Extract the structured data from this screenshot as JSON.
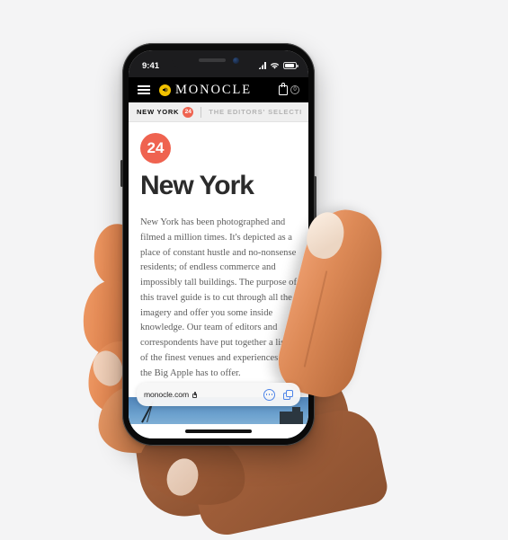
{
  "background_color": "#f4f4f5",
  "device": {
    "name": "iphone-x",
    "frame_color": "#0a0a0a",
    "status_bar": {
      "time": "9:41",
      "icons": [
        "signal-bars-icon",
        "wifi-icon",
        "battery-icon"
      ]
    },
    "home_indicator": true
  },
  "browser": {
    "name": "safari",
    "url": "monocle.com",
    "secure": true,
    "lock_icon": "lock-icon",
    "actions": [
      {
        "name": "page-settings-button",
        "icon": "ellipsis-circle-icon"
      },
      {
        "name": "tabs-button",
        "icon": "tabs-icon"
      }
    ]
  },
  "site_header": {
    "menu_icon": "hamburger-menu-icon",
    "audio_icon": "speaker-icon",
    "audio_badge_color": "#f2c200",
    "brand": "MONOCLE",
    "cart_icon": "shopping-bag-icon",
    "cart_count": "0"
  },
  "section_nav": {
    "tabs": [
      {
        "label": "NEW YORK",
        "badge": "24",
        "active": true
      },
      {
        "label": "THE EDITORS' SELECTI",
        "badge": null,
        "active": false
      }
    ],
    "badge_color": "#ef6350"
  },
  "article": {
    "badge": "24",
    "badge_color": "#ef6350",
    "headline": "New York",
    "body": "New York has been photographed and filmed a million times. It's depicted as a place of constant hustle and no-nonsense residents; of endless commerce and impossibly tall buildings. The purpose of this travel guide is to cut through all the imagery and offer you some inside knowledge. Our team of editors and correspondents have put together a list of the finest venues and experiences that the Big Apple has to offer."
  }
}
